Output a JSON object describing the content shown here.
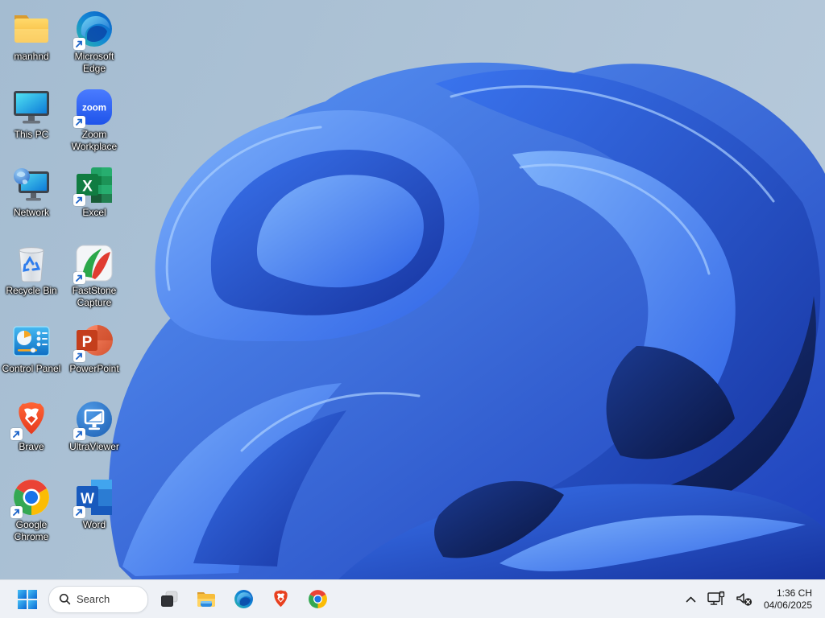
{
  "desktop": {
    "icons": [
      {
        "label": "manhnd",
        "type": "folder",
        "shortcut": false
      },
      {
        "label": "This PC",
        "type": "this-pc",
        "shortcut": false
      },
      {
        "label": "Network",
        "type": "network",
        "shortcut": false
      },
      {
        "label": "Recycle Bin",
        "type": "recycle-bin",
        "shortcut": false
      },
      {
        "label": "Control Panel",
        "type": "control-panel",
        "shortcut": false
      },
      {
        "label": "Brave",
        "type": "brave",
        "shortcut": true
      },
      {
        "label": "Google Chrome",
        "type": "chrome",
        "shortcut": true
      },
      {
        "label": "Microsoft Edge",
        "type": "edge",
        "shortcut": true
      },
      {
        "label": "Zoom Workplace",
        "type": "zoom",
        "shortcut": true
      },
      {
        "label": "Excel",
        "type": "excel",
        "shortcut": true
      },
      {
        "label": "FastStone Capture",
        "type": "faststone",
        "shortcut": true
      },
      {
        "label": "PowerPoint",
        "type": "powerpoint",
        "shortcut": true
      },
      {
        "label": "UltraViewer",
        "type": "ultraviewer",
        "shortcut": true
      },
      {
        "label": "Word",
        "type": "word",
        "shortcut": true
      }
    ]
  },
  "logos": {
    "zoom_text": "zoom",
    "excel_letter": "X",
    "powerpoint_letter": "P",
    "word_letter": "W"
  },
  "taskbar": {
    "search": {
      "label": "Search"
    },
    "pinned": [
      "Task View",
      "File Explorer",
      "Microsoft Edge",
      "Brave",
      "Google Chrome"
    ],
    "tray": {
      "time": "1:36 CH",
      "date": "04/06/2025"
    }
  },
  "colors": {
    "accent": "#0a6fd8",
    "taskbar_bg": "#eef1f6",
    "desktop_sky": "#aec3d6",
    "bloom_blue": "#2563e8",
    "bloom_dark": "#0a153f"
  }
}
